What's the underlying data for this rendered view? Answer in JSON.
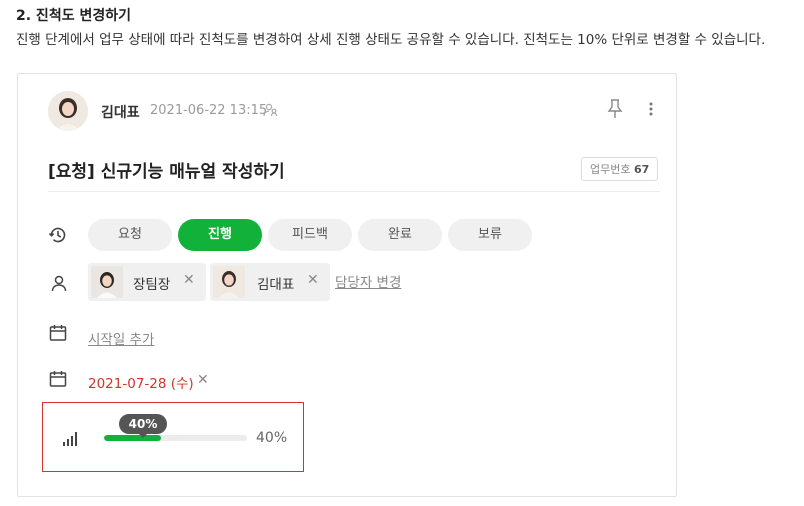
{
  "doc": {
    "heading": "2. 진척도 변경하기",
    "description": "진행 단계에서 업무 상태에 따라 진척도를 변경하여 상세 진행 상태도 공유할 수 있습니다. 진척도는 10% 단위로 변경할 수 있습니다."
  },
  "post": {
    "author": "김대표",
    "datetime": "2021-06-22 13:15",
    "title": "[요청] 신규기능 매뉴얼 작성하기",
    "task_no_label": "업무번호",
    "task_no": "67"
  },
  "status": {
    "options": [
      "요청",
      "진행",
      "피드백",
      "완료",
      "보류"
    ],
    "selected": "진행"
  },
  "assignees": {
    "people": [
      "장팀장",
      "김대표"
    ],
    "change_label": "담당자 변경"
  },
  "dates": {
    "start_add_label": "시작일 추가",
    "due": "2021-07-28 (수)"
  },
  "progress": {
    "value": 40,
    "bubble": "40%",
    "label": "40%"
  },
  "icons": {
    "status_row": "history-icon",
    "assignee_row": "person-icon",
    "start_row": "calendar-icon",
    "due_row": "calendar-icon",
    "progress_row": "signal-bars-icon",
    "viewers": "people-icon",
    "pin": "pin-icon",
    "more": "more-vertical-icon"
  },
  "colors": {
    "accent": "#12b13a",
    "due_date": "#d0342c",
    "highlight": "#d8342b"
  }
}
